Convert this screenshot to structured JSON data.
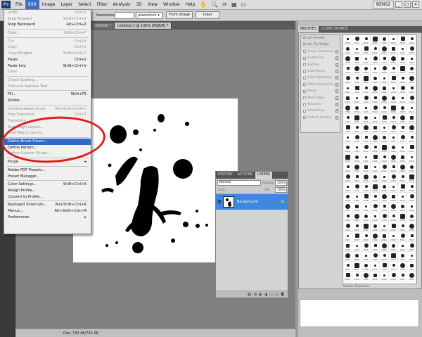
{
  "app": {
    "logo": "Ps",
    "workspace": "BENS2",
    "menus": [
      "File",
      "Edit",
      "Image",
      "Layer",
      "Select",
      "Filter",
      "Analysis",
      "3D",
      "View",
      "Window",
      "Help"
    ],
    "active_menu": "Edit"
  },
  "options": {
    "resolution_label": "Resolution:",
    "resolution_unit": "pixels/inch",
    "front_image": "Front Image",
    "clear": "Clear"
  },
  "doc_tabs": [
    {
      "label": "(RGB/8) *"
    },
    {
      "label": "Untitled-1 @ 100% (RGB/8) *"
    }
  ],
  "status": {
    "doc": "Doc: 732.4K/732.4K"
  },
  "edit_menu": [
    {
      "label": "Undo",
      "shortcut": "Ctrl+Z",
      "disabled": true
    },
    {
      "label": "Step Forward",
      "shortcut": "Shift+Ctrl+Z",
      "disabled": true
    },
    {
      "label": "Step Backward",
      "shortcut": "Alt+Ctrl+Z",
      "disabled": false
    },
    {
      "sep": true
    },
    {
      "label": "Fade...",
      "shortcut": "Shift+Ctrl+F",
      "disabled": true
    },
    {
      "sep": true
    },
    {
      "label": "Cut",
      "shortcut": "Ctrl+X",
      "disabled": true
    },
    {
      "label": "Copy",
      "shortcut": "Ctrl+C",
      "disabled": true
    },
    {
      "label": "Copy Merged",
      "shortcut": "Shift+Ctrl+C",
      "disabled": true
    },
    {
      "label": "Paste",
      "shortcut": "Ctrl+V",
      "disabled": false
    },
    {
      "label": "Paste Into",
      "shortcut": "Shift+Ctrl+V",
      "disabled": false
    },
    {
      "label": "Clear",
      "shortcut": "",
      "disabled": true
    },
    {
      "sep": true
    },
    {
      "label": "Check Spelling...",
      "shortcut": "",
      "disabled": true
    },
    {
      "label": "Find and Replace Text...",
      "shortcut": "",
      "disabled": true
    },
    {
      "sep": true
    },
    {
      "label": "Fill...",
      "shortcut": "Shift+F5",
      "disabled": false
    },
    {
      "label": "Stroke...",
      "shortcut": "",
      "disabled": false
    },
    {
      "sep": true
    },
    {
      "label": "Content-Aware Scale",
      "shortcut": "Alt+Shift+Ctrl+C",
      "disabled": true
    },
    {
      "label": "Free Transform",
      "shortcut": "Ctrl+T",
      "disabled": true
    },
    {
      "label": "Transform",
      "shortcut": "▸",
      "disabled": true
    },
    {
      "label": "Auto-Align Layers...",
      "shortcut": "",
      "disabled": true
    },
    {
      "label": "Auto-Blend Layers...",
      "shortcut": "",
      "disabled": true
    },
    {
      "sep": true
    },
    {
      "label": "Define Brush Preset...",
      "shortcut": "",
      "disabled": false,
      "highlight": true
    },
    {
      "label": "Define Pattern...",
      "shortcut": "",
      "disabled": false
    },
    {
      "label": "Define Custom Shape...",
      "shortcut": "",
      "disabled": true
    },
    {
      "sep": true
    },
    {
      "label": "Purge",
      "shortcut": "▸",
      "disabled": false
    },
    {
      "sep": true
    },
    {
      "label": "Adobe PDF Presets...",
      "shortcut": "",
      "disabled": false
    },
    {
      "label": "Preset Manager...",
      "shortcut": "",
      "disabled": false
    },
    {
      "sep": true
    },
    {
      "label": "Color Settings...",
      "shortcut": "Shift+Ctrl+K",
      "disabled": false
    },
    {
      "label": "Assign Profile...",
      "shortcut": "",
      "disabled": false
    },
    {
      "label": "Convert to Profile...",
      "shortcut": "",
      "disabled": false
    },
    {
      "sep": true
    },
    {
      "label": "Keyboard Shortcuts...",
      "shortcut": "Alt+Shift+Ctrl+K",
      "disabled": false
    },
    {
      "label": "Menus...",
      "shortcut": "Alt+Shift+Ctrl+M",
      "disabled": false
    },
    {
      "label": "Preferences",
      "shortcut": "▸",
      "disabled": false
    }
  ],
  "layers_panel": {
    "tabs": [
      "HISTORY",
      "ACTIONS",
      "LAYERS"
    ],
    "active_tab": "LAYERS",
    "blend_mode": "Normal",
    "opacity_label": "Opacity:",
    "opacity": "100%",
    "lock_label": "Lock:",
    "fill_label": "Fill:",
    "fill": "100%",
    "layer_name": "Background"
  },
  "brushes_panel": {
    "tabs": [
      "BRUSHES",
      "CLONE SOURCE"
    ],
    "active_tab": "BRUSHES",
    "items": [
      "Brush Presets",
      "Brush Tip Shape",
      "Shape Dynamics",
      "Scattering",
      "Texture",
      "Dual Brush",
      "Color Dynamics",
      "Other Dynamics",
      "Noise",
      "Wet Edges",
      "Airbrush",
      "Smoothing",
      "Protect Texture"
    ],
    "master_diameter": "Master Diameter",
    "sizes": [
      "2508",
      "2512",
      "2500",
      "2500",
      "2508",
      "2500",
      "2508",
      "2500",
      "1500",
      "2500",
      "2500",
      "2500",
      "2500",
      "2500",
      "1500",
      "2500",
      "1500",
      "2500",
      "2500",
      "1500",
      "2500",
      "2500",
      "2508",
      "2508",
      "1750",
      "2500",
      "2500",
      "1500",
      "2500",
      "2500",
      "2500"
    ]
  }
}
